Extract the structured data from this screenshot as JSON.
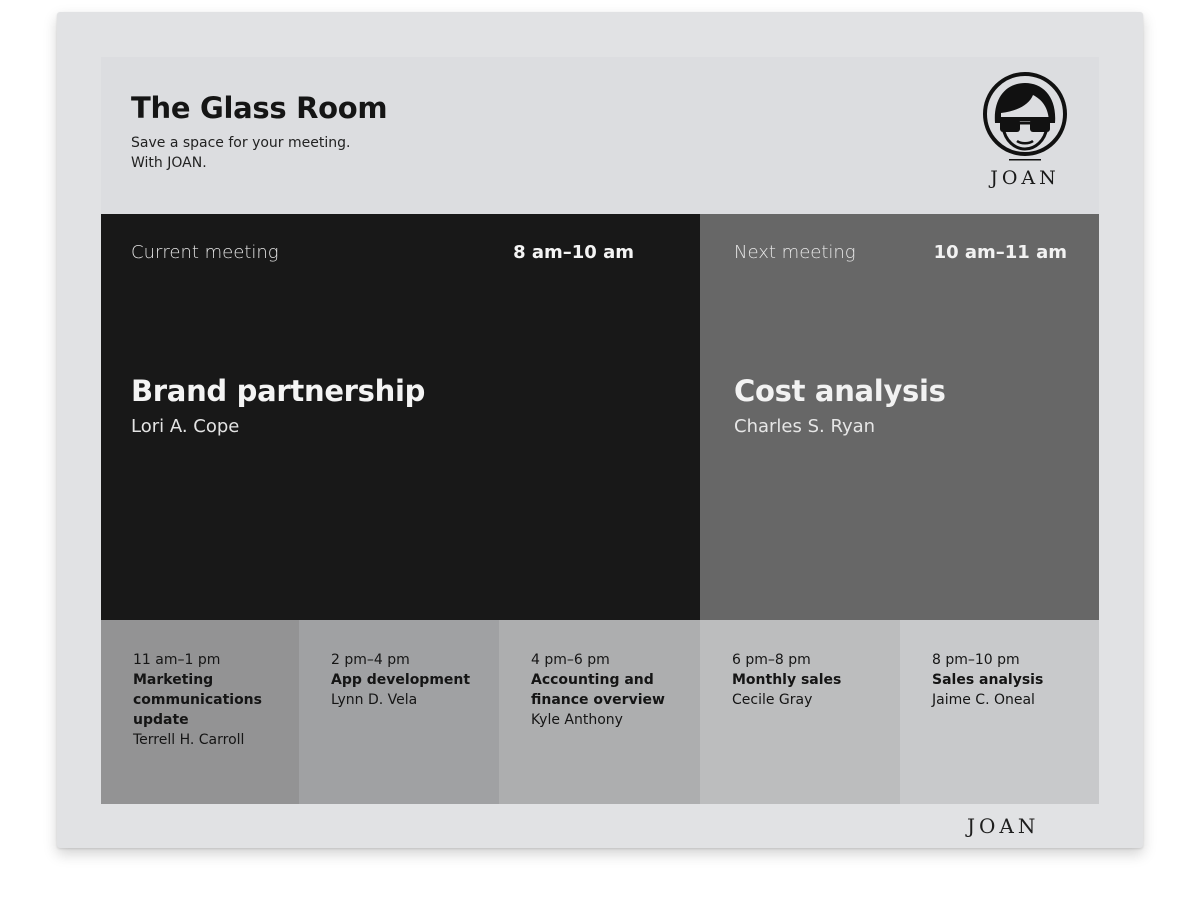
{
  "header": {
    "room_title": "The Glass Room",
    "tagline_line1": "Save a space for your meeting.",
    "tagline_line2": "With JOAN.",
    "logo_text": "JOAN"
  },
  "current_meeting": {
    "label": "Current meeting",
    "time": "8 am–10 am",
    "title": "Brand partnership",
    "host": "Lori A. Cope"
  },
  "next_meeting": {
    "label": "Next meeting",
    "time": "10 am–11 am",
    "title": "Cost analysis",
    "host": "Charles S. Ryan"
  },
  "upcoming": [
    {
      "time": "11 am–1 pm",
      "title": "Marketing communications update",
      "host": "Terrell H. Carroll"
    },
    {
      "time": "2 pm–4 pm",
      "title": "App development",
      "host": "Lynn D. Vela"
    },
    {
      "time": "4 pm–6 pm",
      "title": "Accounting and finance overview",
      "host": "Kyle Anthony"
    },
    {
      "time": "6 pm–8 pm",
      "title": "Monthly sales",
      "host": "Cecile Gray"
    },
    {
      "time": "8 pm–10 pm",
      "title": "Sales analysis",
      "host": "Jaime C. Oneal"
    }
  ],
  "footer": {
    "brand": "JOAN"
  },
  "colors": {
    "current_panel": "#181818",
    "next_panel": "#676767",
    "slot_backgrounds": [
      "#939394",
      "#a0a1a3",
      "#adaeaf",
      "#bcbdbe",
      "#c8c9cb"
    ]
  },
  "icons": {
    "logo": "joan-face-icon"
  }
}
